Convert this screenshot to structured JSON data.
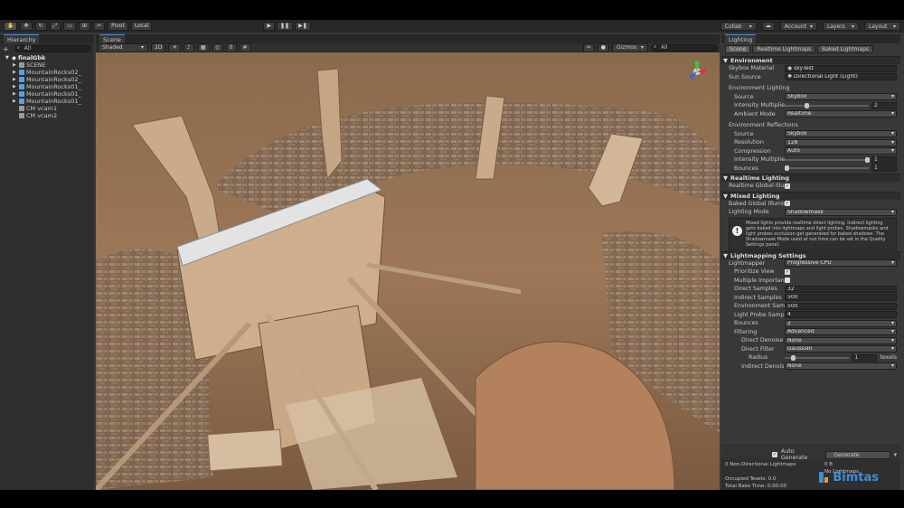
{
  "toolbar": {
    "pivot": "Pivot",
    "local": "Local",
    "collab": "Collab",
    "account": "Account",
    "layers": "Layers",
    "layout": "Layout"
  },
  "hierarchy": {
    "tab": "Hierarchy",
    "search_placeholder": "All",
    "root": "finalGbk",
    "items": [
      {
        "label": "SCENE",
        "icon": "cube-gray"
      },
      {
        "label": "MountainRocks02_",
        "icon": "cube-blue"
      },
      {
        "label": "MountainRocks02_",
        "icon": "cube-blue"
      },
      {
        "label": "MountainRocks01_",
        "icon": "cube-blue"
      },
      {
        "label": "MountainRocks01_",
        "icon": "cube-blue"
      },
      {
        "label": "MountainRocks01_",
        "icon": "cube-blue"
      },
      {
        "label": "CM vcam1",
        "icon": "camera-gray"
      },
      {
        "label": "CM vcam2",
        "icon": "camera-gray"
      }
    ]
  },
  "scene": {
    "tab": "Scene",
    "shading": "Shaded",
    "mode_2d": "2D",
    "gizmos": "Gizmos",
    "search_placeholder": "All",
    "counter": "0"
  },
  "lighting": {
    "tab": "Lighting",
    "subtabs": [
      "Scene",
      "Realtime Lightmaps",
      "Baked Lightmaps"
    ],
    "environment": {
      "title": "Environment",
      "skybox_material_label": "Skybox Material",
      "skybox_material": "skyTest",
      "sun_source_label": "Sun Source",
      "sun_source": "Directional Light (Light)",
      "env_lighting_title": "Environment Lighting",
      "source_label": "Source",
      "source": "Skybox",
      "intensity_label": "Intensity Multiplie",
      "intensity": "2",
      "ambient_label": "Ambient Mode",
      "ambient": "Realtime",
      "env_reflections_title": "Environment Reflections",
      "refl_source_label": "Source",
      "refl_source": "Skybox",
      "resolution_label": "Resolution",
      "resolution": "128",
      "compression_label": "Compression",
      "compression": "Auto",
      "refl_intensity_label": "Intensity Multiplie",
      "refl_intensity": "1",
      "bounces_label": "Bounces",
      "bounces": "1"
    },
    "realtime": {
      "title": "Realtime Lighting",
      "gi_label": "Realtime Global Illum"
    },
    "mixed": {
      "title": "Mixed Lighting",
      "baked_gi_label": "Baked Global Illumin",
      "mode_label": "Lighting Mode",
      "mode": "Shadowmask",
      "help": "Mixed lights provide realtime direct lighting. Indirect lighting gets baked into lightmaps and light probes. Shadowmasks and light probes occlusion get generated for baked shadows. The Shadowmask Mode used at run time can be set in the Quality Settings panel."
    },
    "settings": {
      "title": "Lightmapping Settings",
      "lightmapper_label": "Lightmapper",
      "lightmapper": "Progressive CPU",
      "prioritize_label": "Prioritize View",
      "multiple_label": "Multiple Importanc",
      "direct_samples_label": "Direct Samples",
      "direct_samples": "32",
      "indirect_samples_label": "Indirect Samples",
      "indirect_samples": "500",
      "env_samples_label": "Environment Sam",
      "env_samples": "500",
      "probe_label": "Light Probe Samp",
      "probe": "4",
      "bounces_label": "Bounces",
      "bounces": "2",
      "filtering_label": "Filtering",
      "filtering": "Advanced",
      "direct_denoiser_label": "Direct Denoise",
      "direct_denoiser": "None",
      "direct_filter_label": "Direct Filter",
      "direct_filter": "Gaussian",
      "radius_label": "Radius",
      "radius": "1",
      "radius_unit": "texels",
      "indirect_denoiser_label": "Indirect Denois",
      "indirect_denoiser": "None"
    },
    "auto_generate": "Auto Generate",
    "generate_button": "Generate Lighting",
    "stats": {
      "non_directional": "0 Non-Directional Lightmaps",
      "non_directional_value": "0 B",
      "no_lightmaps": "No Lightmaps",
      "occupied": "Occupied Texels: 0.0",
      "bake_time": "Total Bake Time: 0:00:00"
    }
  },
  "watermark": "Bimtas",
  "colors": {
    "accent": "#4a8cd6",
    "brand": "#3a8fd8"
  }
}
